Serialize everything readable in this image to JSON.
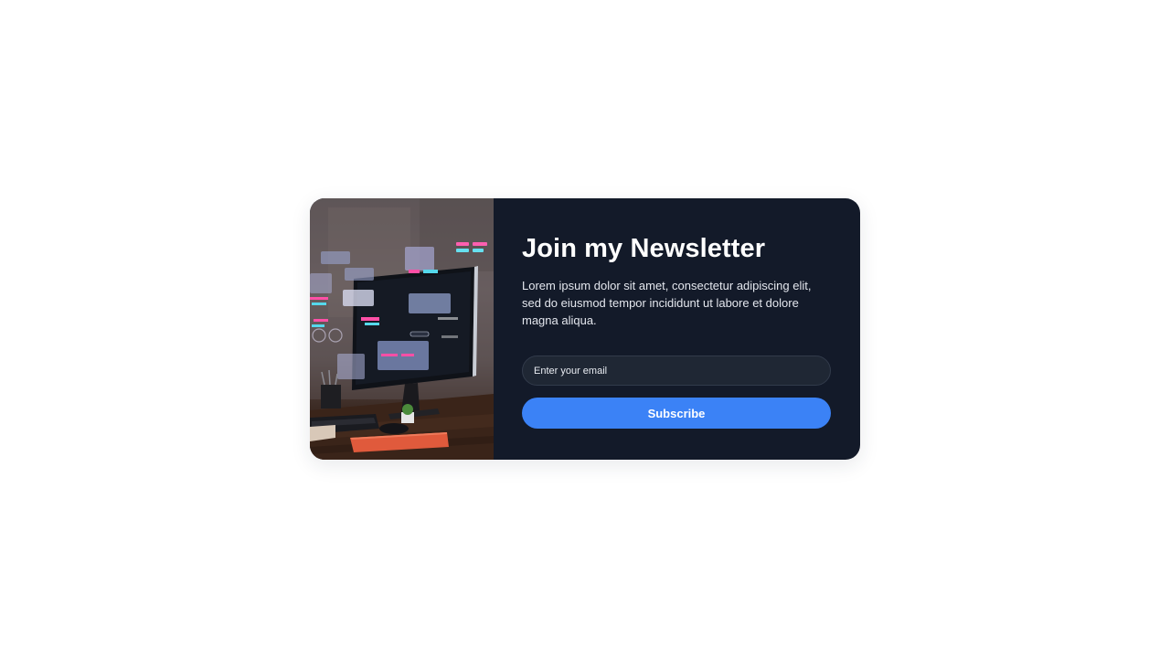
{
  "newsletter": {
    "title": "Join my Newsletter",
    "description": "Lorem ipsum dolor sit amet, consectetur adipiscing elit, sed do eiusmod tempor incididunt ut labore et dolore magna aliqua.",
    "email_placeholder": "Enter your email",
    "email_value": "",
    "subscribe_label": "Subscribe"
  },
  "colors": {
    "page_background": "#ffffff",
    "card_background": "#131a29",
    "input_background": "#1f2734",
    "button_accent": "#3b82f6"
  },
  "image": {
    "subject": "desktop-monitor-with-floating-ui-panels-on-wooden-desk"
  }
}
